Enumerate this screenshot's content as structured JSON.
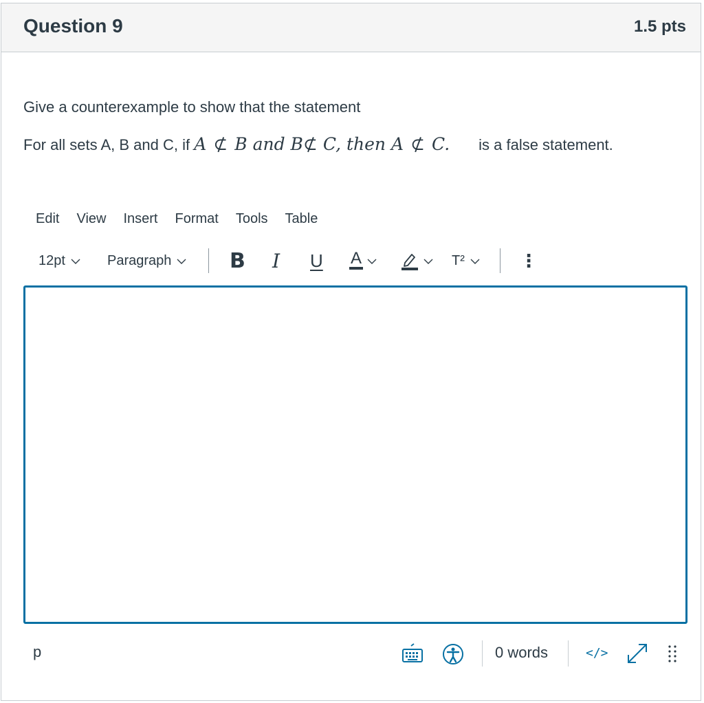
{
  "question": {
    "title": "Question 9",
    "points": "1.5 pts",
    "prompt_line1": "Give a counterexample to show that the statement",
    "prompt_line2_prefix": "For all sets A, B and C, if",
    "math": {
      "a1": "A",
      "not_subset": "⊄",
      "b1": "B",
      "and_word": "and",
      "b2": "B",
      "c1": "C,",
      "then_word": "then",
      "a2": "A",
      "c2": "C."
    },
    "prompt_line2_suffix": "is a false statement."
  },
  "editor": {
    "menu": [
      "Edit",
      "View",
      "Insert",
      "Format",
      "Tools",
      "Table"
    ],
    "toolbar": {
      "font_size": "12pt",
      "block_format": "Paragraph",
      "bold": "B",
      "italic": "I",
      "underline": "U",
      "text_color": "A",
      "superscript": "T²",
      "more": "⋮"
    },
    "status": {
      "path": "p",
      "word_count": "0 words",
      "code_toggle": "</>"
    },
    "accent_color": "#0770a3",
    "icons": [
      "keyboard-icon",
      "accessibility-icon",
      "fullscreen-icon",
      "resize-handle-icon"
    ]
  }
}
